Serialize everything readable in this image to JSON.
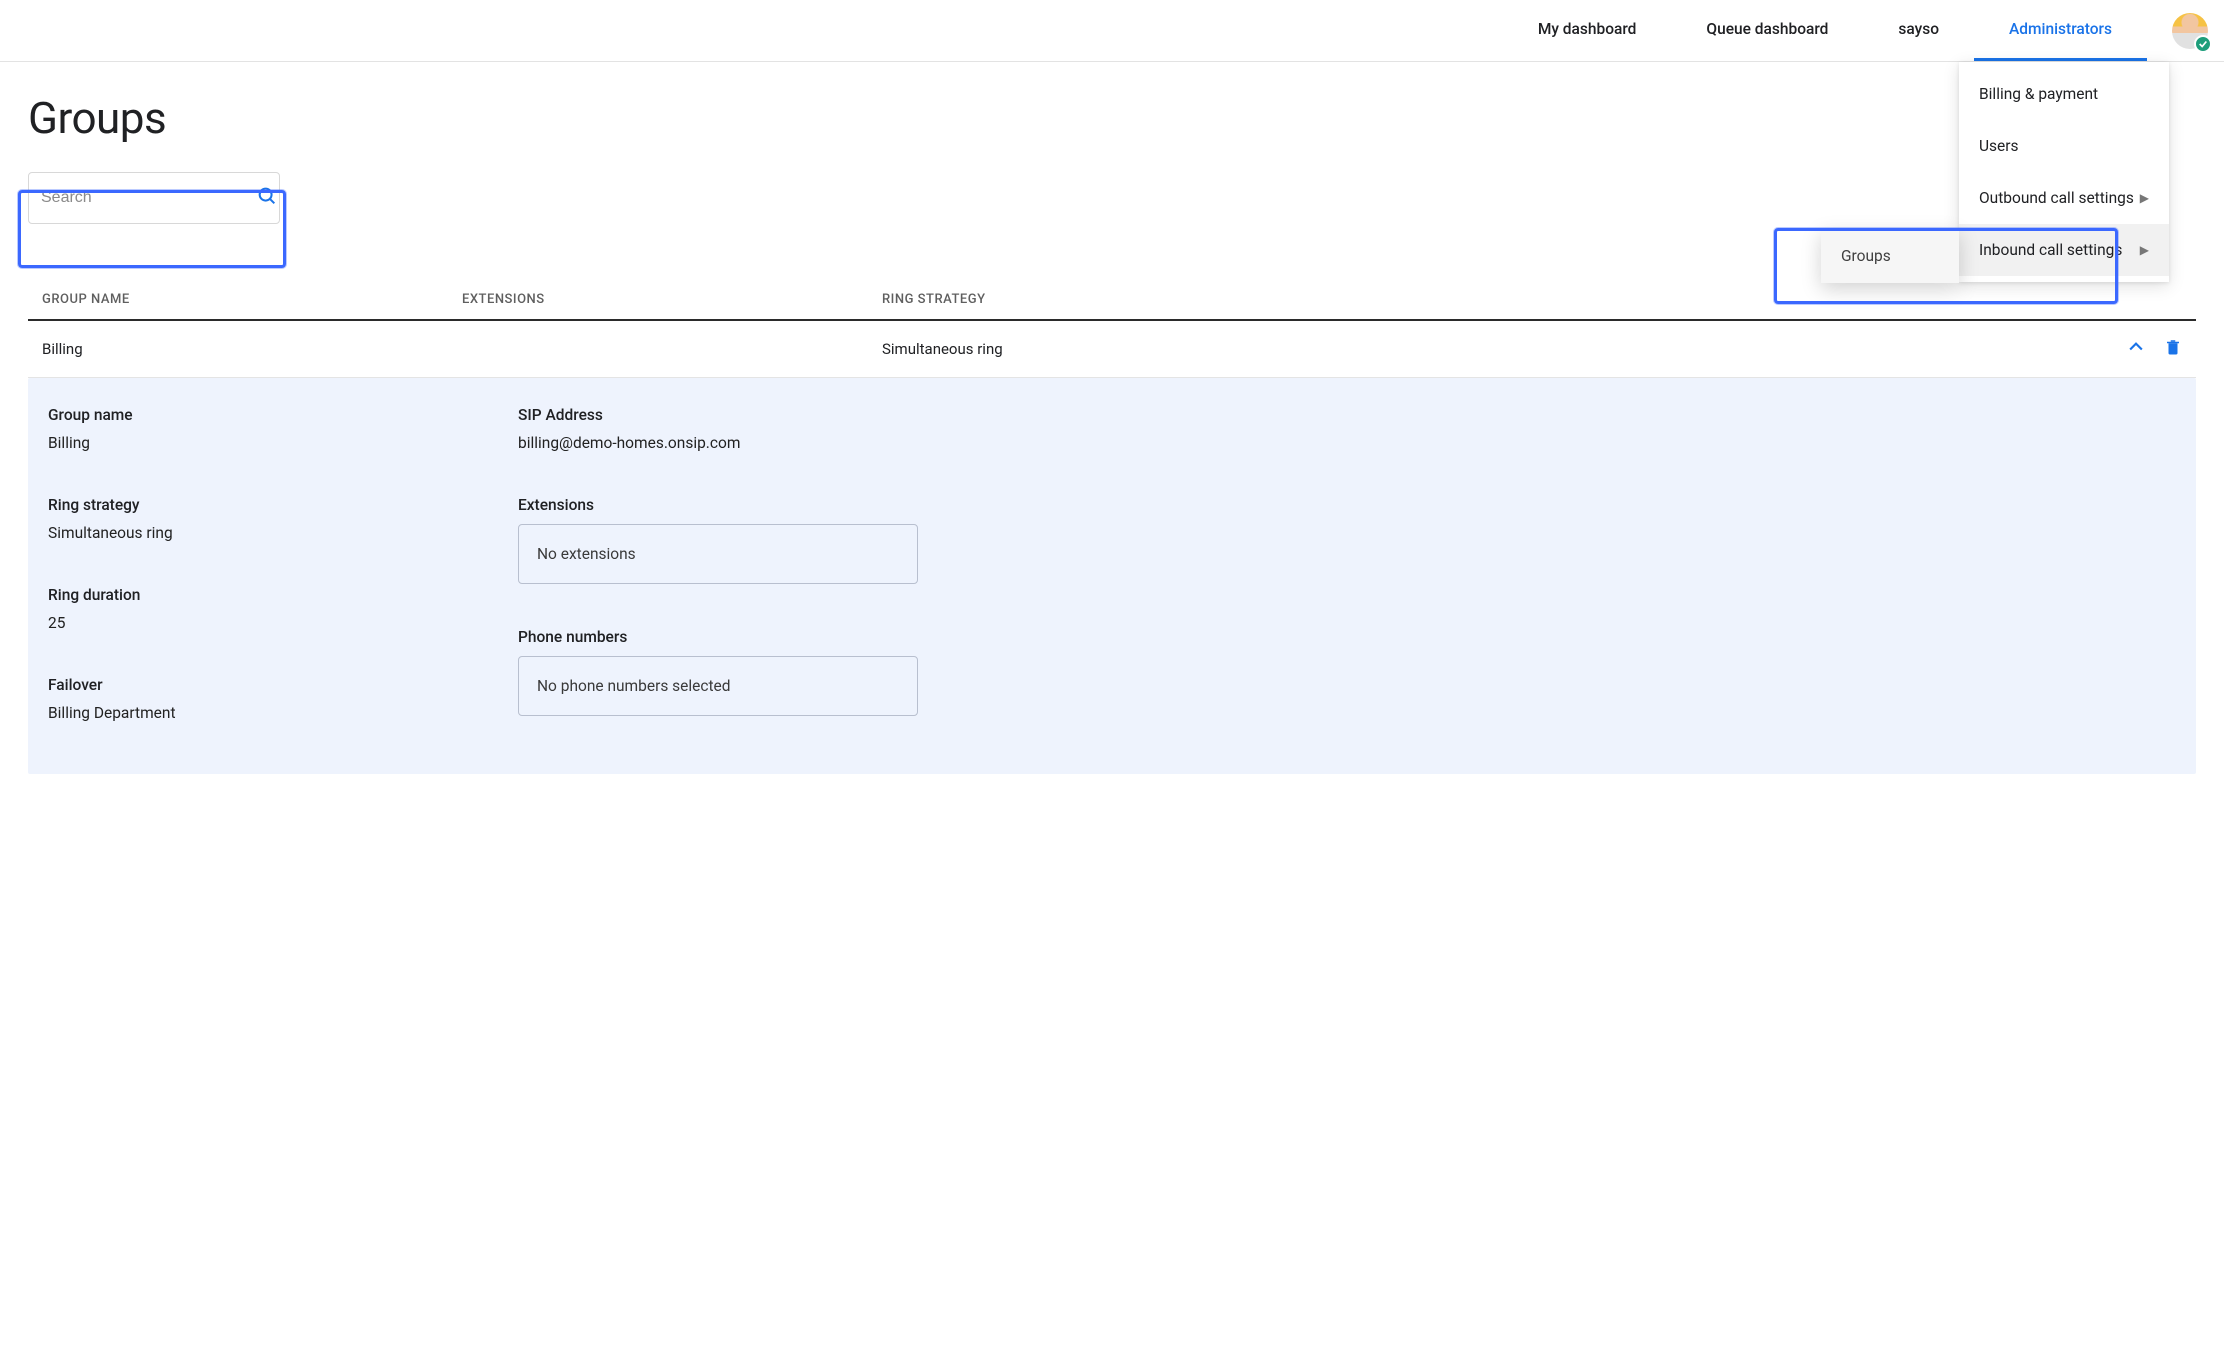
{
  "nav": {
    "tabs": [
      {
        "label": "My dashboard"
      },
      {
        "label": "Queue dashboard"
      },
      {
        "label": "sayso"
      },
      {
        "label": "Administrators"
      }
    ],
    "activeIndex": 3
  },
  "dropdown": {
    "items": [
      {
        "label": "Billing & payment",
        "hasSubmenu": false
      },
      {
        "label": "Users",
        "hasSubmenu": false
      },
      {
        "label": "Outbound call settings",
        "hasSubmenu": true
      },
      {
        "label": "Inbound call settings",
        "hasSubmenu": true
      }
    ],
    "highlightedIndex": 3,
    "submenu": {
      "label": "Groups"
    }
  },
  "page": {
    "title": "Groups"
  },
  "search": {
    "placeholder": "Search",
    "value": ""
  },
  "table": {
    "headers": {
      "group_name": "GROUP NAME",
      "extensions": "EXTENSIONS",
      "ring_strategy": "RING STRATEGY"
    },
    "rows": [
      {
        "group_name": "Billing",
        "extensions": "",
        "ring_strategy": "Simultaneous ring"
      }
    ]
  },
  "details": {
    "left": {
      "group_name_label": "Group name",
      "group_name_value": "Billing",
      "ring_strategy_label": "Ring strategy",
      "ring_strategy_value": "Simultaneous ring",
      "ring_duration_label": "Ring duration",
      "ring_duration_value": "25",
      "failover_label": "Failover",
      "failover_value": "Billing Department"
    },
    "right": {
      "sip_label": "SIP Address",
      "sip_value": "billing@demo-homes.onsip.com",
      "extensions_label": "Extensions",
      "extensions_box": "No extensions",
      "phone_label": "Phone numbers",
      "phone_box": "No phone numbers selected"
    }
  }
}
